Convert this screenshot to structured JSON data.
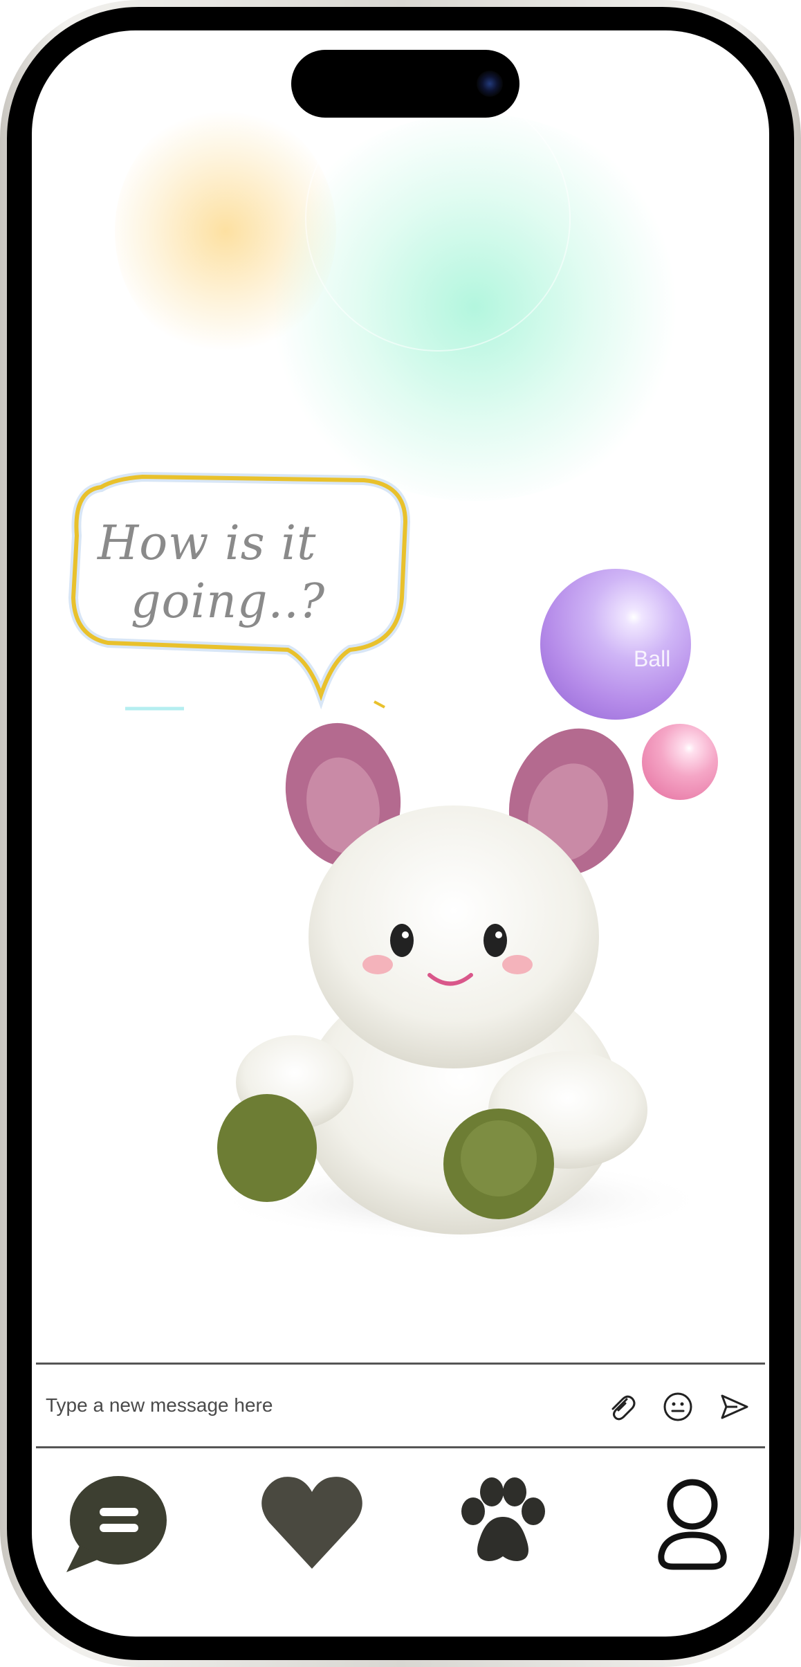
{
  "composer": {
    "placeholder": "Type a new message here",
    "icons": [
      "paperclip-icon",
      "smiley-icon",
      "send-icon"
    ]
  },
  "bubble": {
    "line1": "How is it",
    "line2": "going..?"
  },
  "balls": {
    "purple_label": "Ball"
  },
  "nav": {
    "items": [
      {
        "name": "chat",
        "icon": "chat-bubble-icon",
        "active": true
      },
      {
        "name": "favorites",
        "icon": "heart-icon",
        "active": false
      },
      {
        "name": "pet",
        "icon": "paw-icon",
        "active": false
      },
      {
        "name": "profile",
        "icon": "person-icon",
        "active": false
      }
    ]
  },
  "colors": {
    "nav_icon": "#4a4940",
    "chat_icon_bg": "#3d3f31",
    "bubble_outline": "#e9c12c",
    "plush_ears": "#b46a8f",
    "plush_feet": "#6d7d34"
  }
}
